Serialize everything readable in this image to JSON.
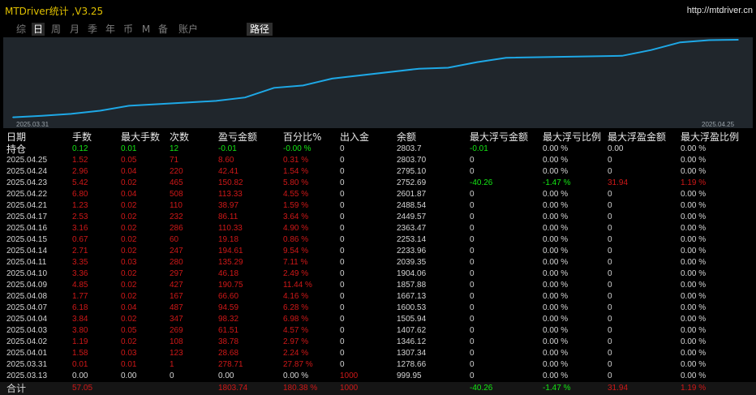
{
  "window": {
    "title": "MTDriver统计 ,V3.25",
    "url": "http://mtdriver.cn"
  },
  "tabs": [
    {
      "label": "综",
      "active": false
    },
    {
      "label": "日",
      "active": true
    },
    {
      "label": "周",
      "active": false
    },
    {
      "label": "月",
      "active": false
    },
    {
      "label": "季",
      "active": false
    },
    {
      "label": "年",
      "active": false
    },
    {
      "label": "币",
      "active": false
    },
    {
      "label": "M",
      "active": false
    },
    {
      "label": "备",
      "active": false
    },
    {
      "label": "账户",
      "active": false
    }
  ],
  "route_tab": "路径",
  "chart_data": {
    "type": "line",
    "x_start_label": "2025.03.31",
    "x_end_label": "2025.04.25",
    "line_color": "#1ea8e6",
    "background": "#20262c",
    "x": [
      "2025.03.31",
      "2025.04.01",
      "2025.04.02",
      "2025.04.03",
      "2025.04.04",
      "2025.04.07",
      "2025.04.08",
      "2025.04.09",
      "2025.04.10",
      "2025.04.11",
      "2025.04.14",
      "2025.04.15",
      "2025.04.16",
      "2025.04.17",
      "2025.04.21",
      "2025.04.22",
      "2025.04.23",
      "2025.04.24",
      "2025.04.25"
    ],
    "values": [
      1278.66,
      1307.34,
      1346.12,
      1407.62,
      1505.94,
      1600.53,
      1667.13,
      1857.88,
      1904.06,
      2039.35,
      2233.96,
      2253.14,
      2363.47,
      2449.57,
      2488.54,
      2601.87,
      2752.69,
      2795.1,
      2803.7
    ]
  },
  "columns": [
    "日期",
    "手数",
    "最大手数",
    "次数",
    "盈亏金额",
    "百分比%",
    "出入金",
    "余额",
    "最大浮亏金额",
    "最大浮亏比例",
    "最大浮盈金额",
    "最大浮盈比例"
  ],
  "holding": {
    "label": "持仓",
    "lots": "0.12",
    "max_lots": "0.01",
    "count": "12",
    "pnl": "-0.01",
    "pct": "-0.00 %",
    "deposit": "0",
    "balance": "2803.7",
    "max_float_loss": "-0.01",
    "max_float_loss_pct": "0.00 %",
    "max_float_profit": "0.00",
    "max_float_profit_pct": "0.00 %"
  },
  "rows": [
    {
      "date": "2025.04.25",
      "lots": "1.52",
      "max_lots": "0.05",
      "count": "71",
      "pnl": "8.60",
      "pct": "0.31 %",
      "deposit": "0",
      "balance": "2803.70",
      "mfl": "0",
      "mflp": "0.00 %",
      "mfp": "0",
      "mfpp": "0.00 %"
    },
    {
      "date": "2025.04.24",
      "lots": "2.96",
      "max_lots": "0.04",
      "count": "220",
      "pnl": "42.41",
      "pct": "1.54 %",
      "deposit": "0",
      "balance": "2795.10",
      "mfl": "0",
      "mflp": "0.00 %",
      "mfp": "0",
      "mfpp": "0.00 %"
    },
    {
      "date": "2025.04.23",
      "lots": "5.42",
      "max_lots": "0.02",
      "count": "465",
      "pnl": "150.82",
      "pct": "5.80 %",
      "deposit": "0",
      "balance": "2752.69",
      "mfl": "-40.26",
      "mflp": "-1.47 %",
      "mfp": "31.94",
      "mfpp": "1.19 %"
    },
    {
      "date": "2025.04.22",
      "lots": "6.80",
      "max_lots": "0.04",
      "count": "508",
      "pnl": "113.33",
      "pct": "4.55 %",
      "deposit": "0",
      "balance": "2601.87",
      "mfl": "0",
      "mflp": "0.00 %",
      "mfp": "0",
      "mfpp": "0.00 %"
    },
    {
      "date": "2025.04.21",
      "lots": "1.23",
      "max_lots": "0.02",
      "count": "110",
      "pnl": "38.97",
      "pct": "1.59 %",
      "deposit": "0",
      "balance": "2488.54",
      "mfl": "0",
      "mflp": "0.00 %",
      "mfp": "0",
      "mfpp": "0.00 %"
    },
    {
      "date": "2025.04.17",
      "lots": "2.53",
      "max_lots": "0.02",
      "count": "232",
      "pnl": "86.11",
      "pct": "3.64 %",
      "deposit": "0",
      "balance": "2449.57",
      "mfl": "0",
      "mflp": "0.00 %",
      "mfp": "0",
      "mfpp": "0.00 %"
    },
    {
      "date": "2025.04.16",
      "lots": "3.16",
      "max_lots": "0.02",
      "count": "286",
      "pnl": "110.33",
      "pct": "4.90 %",
      "deposit": "0",
      "balance": "2363.47",
      "mfl": "0",
      "mflp": "0.00 %",
      "mfp": "0",
      "mfpp": "0.00 %"
    },
    {
      "date": "2025.04.15",
      "lots": "0.67",
      "max_lots": "0.02",
      "count": "60",
      "pnl": "19.18",
      "pct": "0.86 %",
      "deposit": "0",
      "balance": "2253.14",
      "mfl": "0",
      "mflp": "0.00 %",
      "mfp": "0",
      "mfpp": "0.00 %"
    },
    {
      "date": "2025.04.14",
      "lots": "2.71",
      "max_lots": "0.02",
      "count": "247",
      "pnl": "194.61",
      "pct": "9.54 %",
      "deposit": "0",
      "balance": "2233.96",
      "mfl": "0",
      "mflp": "0.00 %",
      "mfp": "0",
      "mfpp": "0.00 %"
    },
    {
      "date": "2025.04.11",
      "lots": "3.35",
      "max_lots": "0.03",
      "count": "280",
      "pnl": "135.29",
      "pct": "7.11 %",
      "deposit": "0",
      "balance": "2039.35",
      "mfl": "0",
      "mflp": "0.00 %",
      "mfp": "0",
      "mfpp": "0.00 %"
    },
    {
      "date": "2025.04.10",
      "lots": "3.36",
      "max_lots": "0.02",
      "count": "297",
      "pnl": "46.18",
      "pct": "2.49 %",
      "deposit": "0",
      "balance": "1904.06",
      "mfl": "0",
      "mflp": "0.00 %",
      "mfp": "0",
      "mfpp": "0.00 %"
    },
    {
      "date": "2025.04.09",
      "lots": "4.85",
      "max_lots": "0.02",
      "count": "427",
      "pnl": "190.75",
      "pct": "11.44 %",
      "deposit": "0",
      "balance": "1857.88",
      "mfl": "0",
      "mflp": "0.00 %",
      "mfp": "0",
      "mfpp": "0.00 %"
    },
    {
      "date": "2025.04.08",
      "lots": "1.77",
      "max_lots": "0.02",
      "count": "167",
      "pnl": "66.60",
      "pct": "4.16 %",
      "deposit": "0",
      "balance": "1667.13",
      "mfl": "0",
      "mflp": "0.00 %",
      "mfp": "0",
      "mfpp": "0.00 %"
    },
    {
      "date": "2025.04.07",
      "lots": "6.18",
      "max_lots": "0.04",
      "count": "487",
      "pnl": "94.59",
      "pct": "6.28 %",
      "deposit": "0",
      "balance": "1600.53",
      "mfl": "0",
      "mflp": "0.00 %",
      "mfp": "0",
      "mfpp": "0.00 %"
    },
    {
      "date": "2025.04.04",
      "lots": "3.84",
      "max_lots": "0.02",
      "count": "347",
      "pnl": "98.32",
      "pct": "6.98 %",
      "deposit": "0",
      "balance": "1505.94",
      "mfl": "0",
      "mflp": "0.00 %",
      "mfp": "0",
      "mfpp": "0.00 %"
    },
    {
      "date": "2025.04.03",
      "lots": "3.80",
      "max_lots": "0.05",
      "count": "269",
      "pnl": "61.51",
      "pct": "4.57 %",
      "deposit": "0",
      "balance": "1407.62",
      "mfl": "0",
      "mflp": "0.00 %",
      "mfp": "0",
      "mfpp": "0.00 %"
    },
    {
      "date": "2025.04.02",
      "lots": "1.19",
      "max_lots": "0.02",
      "count": "108",
      "pnl": "38.78",
      "pct": "2.97 %",
      "deposit": "0",
      "balance": "1346.12",
      "mfl": "0",
      "mflp": "0.00 %",
      "mfp": "0",
      "mfpp": "0.00 %"
    },
    {
      "date": "2025.04.01",
      "lots": "1.58",
      "max_lots": "0.03",
      "count": "123",
      "pnl": "28.68",
      "pct": "2.24 %",
      "deposit": "0",
      "balance": "1307.34",
      "mfl": "0",
      "mflp": "0.00 %",
      "mfp": "0",
      "mfpp": "0.00 %"
    },
    {
      "date": "2025.03.31",
      "lots": "0.01",
      "max_lots": "0.01",
      "count": "1",
      "pnl": "278.71",
      "pct": "27.87 %",
      "deposit": "0",
      "balance": "1278.66",
      "mfl": "0",
      "mflp": "0.00 %",
      "mfp": "0",
      "mfpp": "0.00 %"
    },
    {
      "date": "2025.03.13",
      "lots": "0.00",
      "max_lots": "0.00",
      "count": "0",
      "pnl": "0.00",
      "pct": "0.00 %",
      "deposit": "1000",
      "balance": "999.95",
      "mfl": "0",
      "mflp": "0.00 %",
      "mfp": "0",
      "mfpp": "0.00 %"
    }
  ],
  "total": {
    "label": "合计",
    "lots": "57.05",
    "pnl": "1803.74",
    "pct": "180.38 %",
    "deposit": "1000",
    "mfl": "-40.26",
    "mflp": "-1.47 %",
    "mfp": "31.94",
    "mfpp": "1.19 %"
  },
  "colors": {
    "title": "#e0c000",
    "positive": "#d01818",
    "negative": "#14e614",
    "neutral": "#d6d6d6"
  }
}
